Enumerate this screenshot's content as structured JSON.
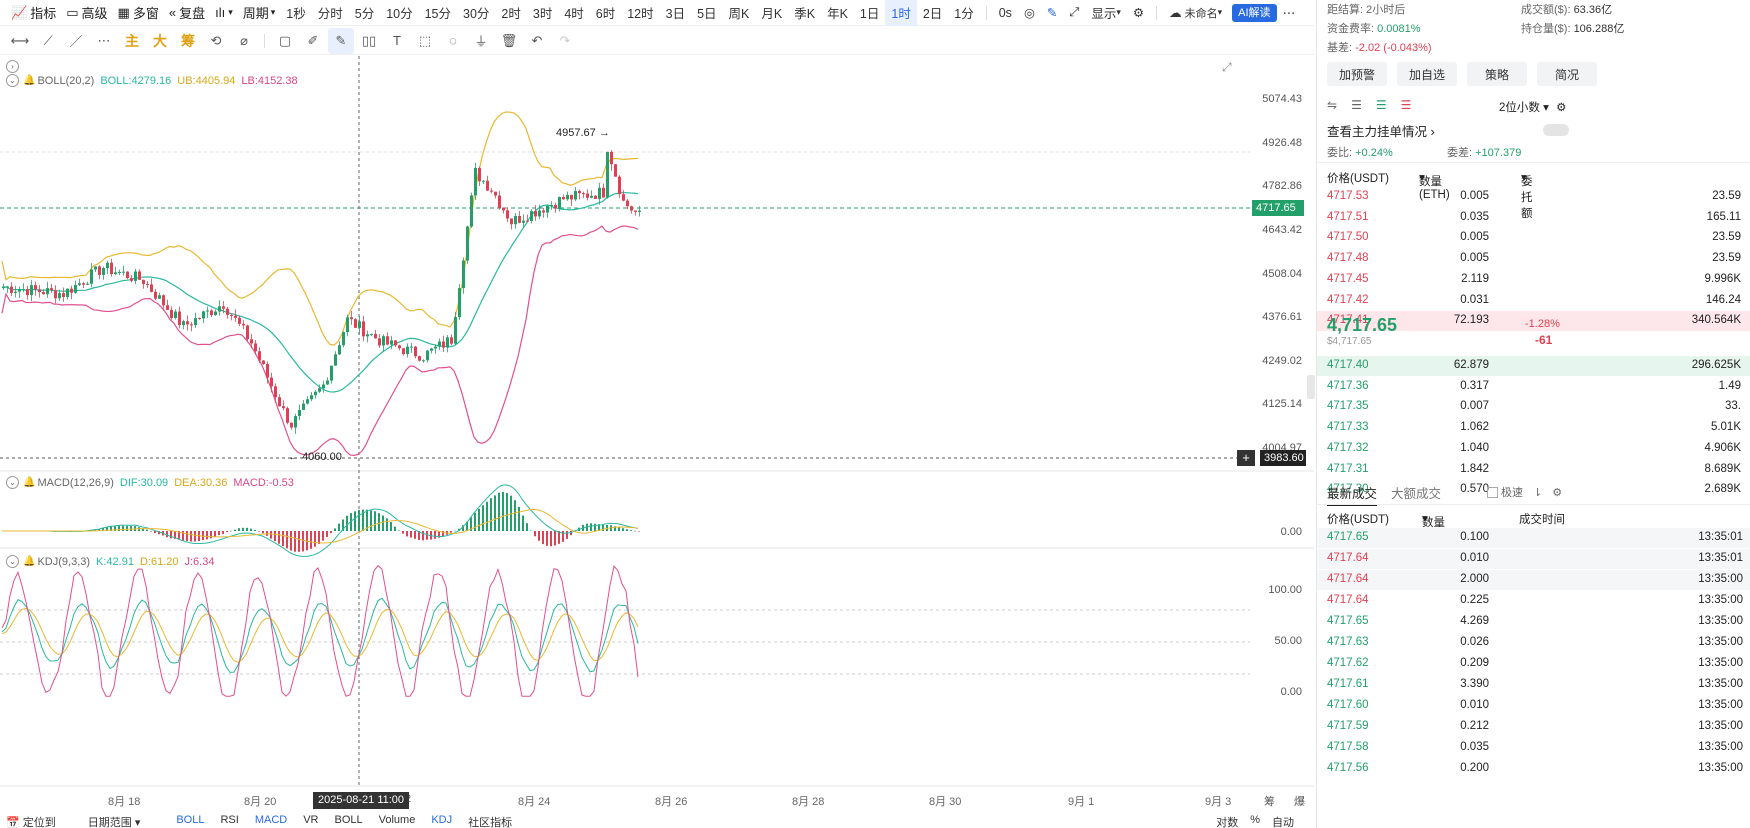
{
  "toolbar": {
    "indicator": "指标",
    "advanced": "高级",
    "multi_window": "多窗",
    "replay": "复盘",
    "period": "周期",
    "intervals": [
      "1秒",
      "分时",
      "5分",
      "10分",
      "15分",
      "30分",
      "2时",
      "3时",
      "4时",
      "6时",
      "12时",
      "3日",
      "5日",
      "周K",
      "月K",
      "季K",
      "年K",
      "1日",
      "1时",
      "2日",
      "1分"
    ],
    "active_interval": "1时",
    "countdown": "0s",
    "display": "显示",
    "layout_name": "未命名",
    "ai_btn": "AI解读"
  },
  "draw_tools": {
    "main": "主",
    "big": "大",
    "chips": "筹"
  },
  "boll": {
    "name": "BOLL(20,2)",
    "boll": "BOLL:4279.16",
    "ub": "UB:4405.94",
    "lb": "LB:4152.38"
  },
  "macd": {
    "name": "MACD(12,26,9)",
    "dif": "DIF:30.09",
    "dea": "DEA:30.36",
    "macd": "MACD:-0.53"
  },
  "kdj": {
    "name": "KDJ(9,3,3)",
    "k": "K:42.91",
    "d": "D:61.20",
    "j": "J:6.34"
  },
  "price_axis": [
    "5074.43",
    "4926.48",
    "4782.86",
    "4643.42",
    "4508.04",
    "4376.61",
    "4249.02",
    "4125.14",
    "4004.97"
  ],
  "current_price_tag": "4717.65",
  "cursor_price_tag": "3983.60",
  "high_label": "4957.67",
  "low_label": "4060.00",
  "macd_axis": [
    "0.00"
  ],
  "kdj_axis": [
    "100.00",
    "50.00",
    "0.00"
  ],
  "x_axis": [
    "8月 18",
    "8月 20",
    "8月 24",
    "8月 26",
    "8月 28",
    "8月 30",
    "9月 1",
    "9月 3"
  ],
  "x_axis_partial": "2",
  "cursor_time": "2025-08-21 11:00",
  "axis_corner": [
    "筹",
    "爆"
  ],
  "bottom_tabs": {
    "locate": "定位到",
    "date_range": "日期范围",
    "items": [
      "BOLL",
      "RSI",
      "MACD",
      "VR",
      "BOLL",
      "Volume",
      "KDJ",
      "社区指标"
    ],
    "right": [
      "对数",
      "%",
      "自动"
    ]
  },
  "colors": {
    "up": "#23a06a",
    "down": "#e04152",
    "boll_mid": "#29b8a0",
    "boll_ub": "#e8b830",
    "boll_lb": "#e0508f",
    "accent": "#2a6ae0"
  },
  "right": {
    "settle_label": "距结算:",
    "settle_value": "2小时后",
    "volume_label": "成交额($):",
    "volume_value": "63.36亿",
    "funding_label": "资金费率:",
    "funding_value": "0.0081%",
    "oi_label": "持仓量($):",
    "oi_value": "106.288亿",
    "basis_label": "基差:",
    "basis_value": "-2.02 (-0.043%)",
    "buttons": [
      "加预警",
      "加自选",
      "策略",
      "简况"
    ],
    "precision": "2位小数",
    "depth_link": "查看主力挂单情况",
    "ratio_label": "委比:",
    "ratio_value": "+0.24%",
    "diff_label": "委差:",
    "diff_value": "+107.379",
    "ob_headers": [
      "价格(USDT)",
      "数量 (ETH)",
      "委托额"
    ],
    "asks": [
      [
        "4717.53",
        "0.005",
        "23.59"
      ],
      [
        "4717.51",
        "0.035",
        "165.11"
      ],
      [
        "4717.50",
        "0.005",
        "23.59"
      ],
      [
        "4717.48",
        "0.005",
        "23.59"
      ],
      [
        "4717.45",
        "2.119",
        "9.996K"
      ],
      [
        "4717.42",
        "0.031",
        "146.24"
      ],
      [
        "4717.41",
        "72.193",
        "340.564K"
      ]
    ],
    "last_price": "4,717.65",
    "last_usd": "$4,717.65",
    "change_pct": "-1.28%",
    "change_abs": "-61",
    "bids": [
      [
        "4717.40",
        "62.879",
        "296.625K"
      ],
      [
        "4717.36",
        "0.317",
        "1.49"
      ],
      [
        "4717.35",
        "0.007",
        "33."
      ],
      [
        "4717.33",
        "1.062",
        "5.01K"
      ],
      [
        "4717.32",
        "1.040",
        "4.906K"
      ],
      [
        "4717.31",
        "1.842",
        "8.689K"
      ],
      [
        "4717.30",
        "0.570",
        "2.689K"
      ]
    ],
    "trade_tabs": [
      "最新成交",
      "大额成交"
    ],
    "fast_label": "极速",
    "trade_headers": [
      "价格(USDT)",
      "数量(ETH)",
      "成交时间"
    ],
    "trades": [
      [
        "4717.65",
        "0.100",
        "13:35:01",
        "g"
      ],
      [
        "4717.64",
        "0.010",
        "13:35:01",
        "r"
      ],
      [
        "4717.64",
        "2.000",
        "13:35:00",
        "r"
      ],
      [
        "4717.64",
        "0.225",
        "13:35:00",
        "r"
      ],
      [
        "4717.65",
        "4.269",
        "13:35:00",
        "g"
      ],
      [
        "4717.63",
        "0.026",
        "13:35:00",
        "g"
      ],
      [
        "4717.62",
        "0.209",
        "13:35:00",
        "g"
      ],
      [
        "4717.61",
        "3.390",
        "13:35:00",
        "g"
      ],
      [
        "4717.60",
        "0.010",
        "13:35:00",
        "g"
      ],
      [
        "4717.59",
        "0.212",
        "13:35:00",
        "g"
      ],
      [
        "4717.58",
        "0.035",
        "13:35:00",
        "g"
      ],
      [
        "4717.56",
        "0.200",
        "13:35:00",
        "g"
      ]
    ]
  }
}
